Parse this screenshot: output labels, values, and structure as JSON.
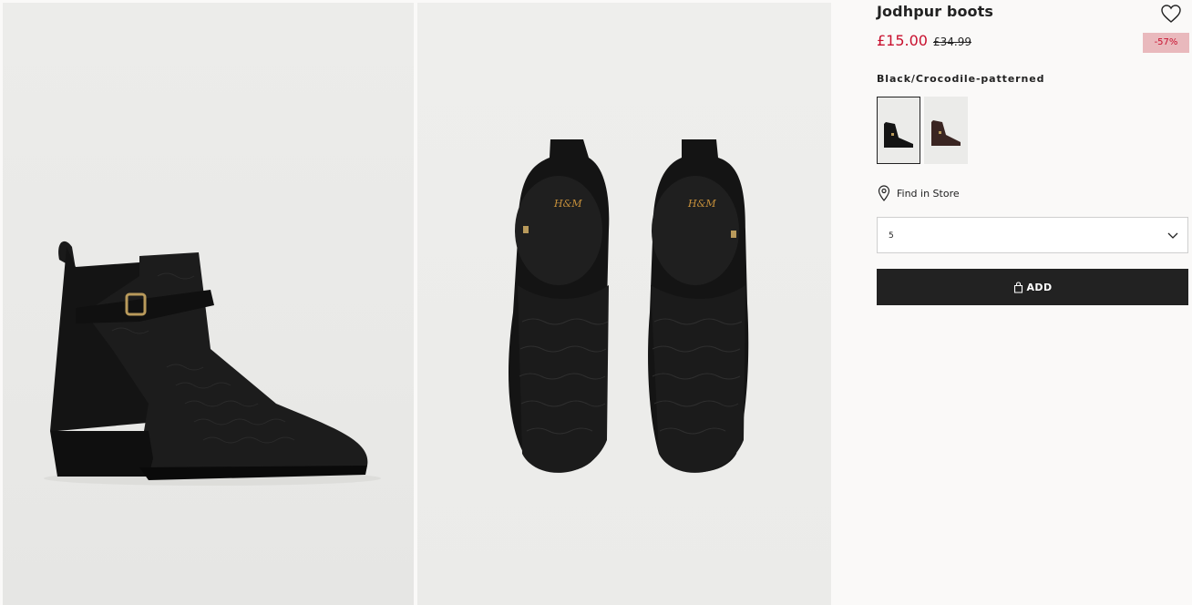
{
  "product": {
    "title": "Jodhpur boots",
    "price_sale": "£15.00",
    "price_old": "£34.99",
    "discount": "-57%",
    "color_name": "Black/Crocodile-patterned"
  },
  "images": [
    {
      "alt": "Jodhpur boots side view"
    },
    {
      "alt": "Jodhpur boots top view"
    }
  ],
  "swatches": [
    {
      "name": "Black/Crocodile-patterned",
      "selected": true
    },
    {
      "name": "Dark brown",
      "selected": false
    }
  ],
  "store": {
    "label": "Find in Store",
    "icon": "location-pin-icon"
  },
  "size_select": {
    "value": "5",
    "icon": "chevron-down-icon"
  },
  "add_button": {
    "label": "ADD",
    "icon": "shopping-bag-icon"
  },
  "favorite": {
    "icon": "heart-icon"
  },
  "colors": {
    "sale": "#c8102e",
    "discount_bg": "#e9b9bd",
    "button_bg": "#222222",
    "background": "#faf9f8"
  }
}
